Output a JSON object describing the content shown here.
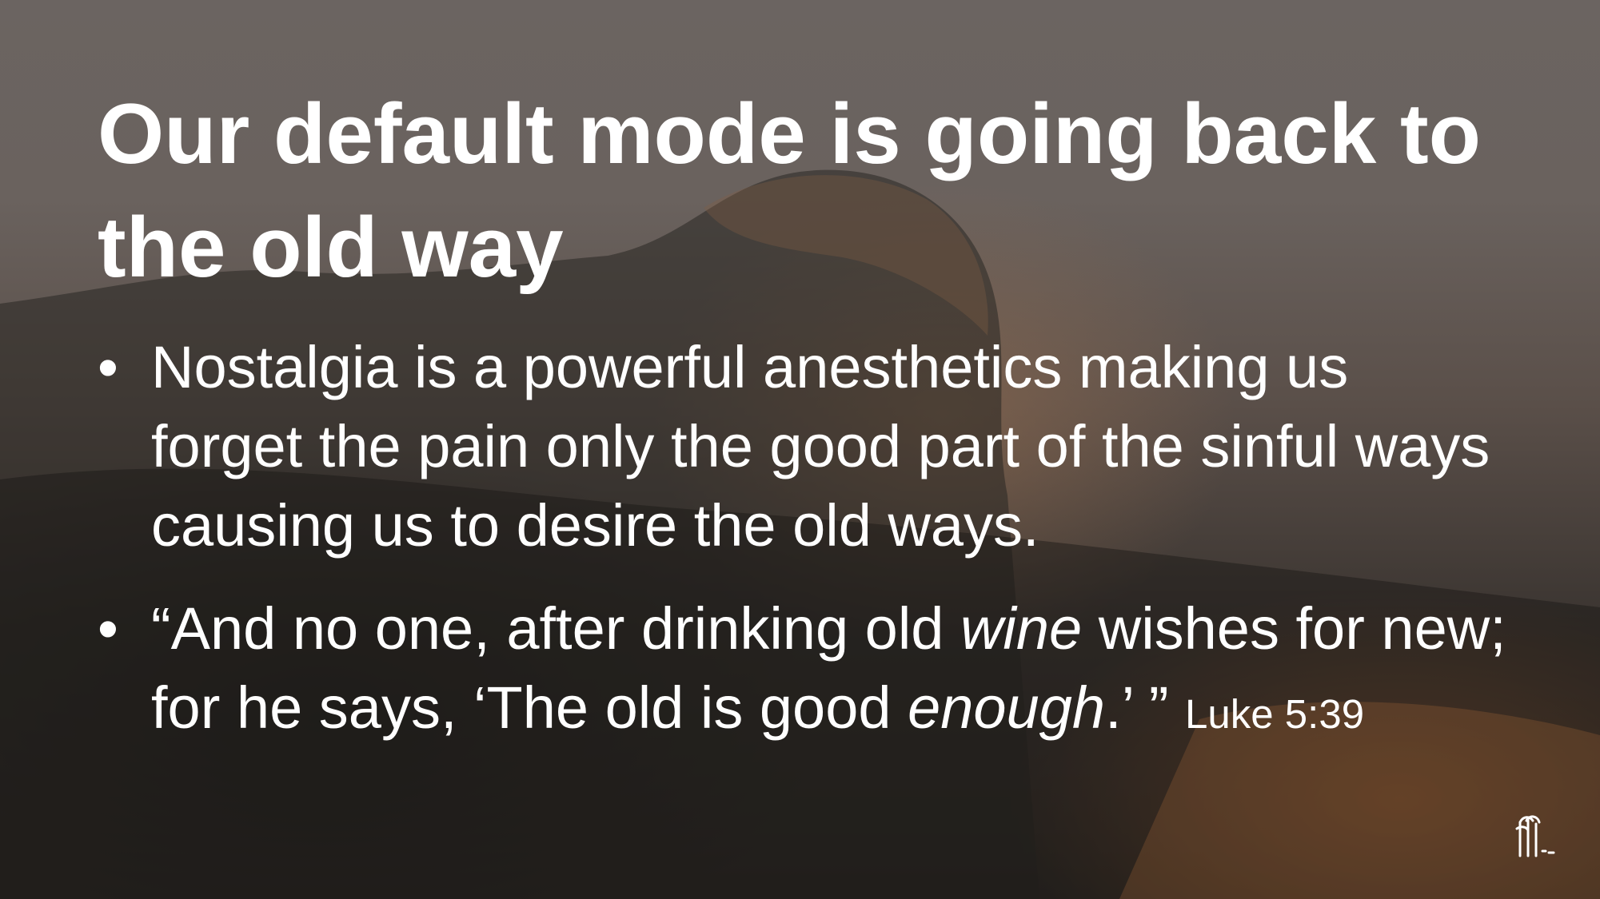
{
  "slide": {
    "title": "Our default mode is going back to the old way",
    "bullets": [
      {
        "text": "Nostalgia is a powerful anesthetics making us forget the pain only the good part of the sinful ways causing us to desire the old ways."
      },
      {
        "part1": "“And no one, after drinking old ",
        "italic1": "wine",
        "part2": " wishes for new; for he says, ‘The old is good ",
        "italic2": "enough",
        "part3": ".’ ” ",
        "reference": "Luke 5:39"
      }
    ],
    "bullet_symbol": "•"
  },
  "colors": {
    "text": "#ffffff"
  },
  "icons": {
    "logo": "church-logo-icon"
  }
}
